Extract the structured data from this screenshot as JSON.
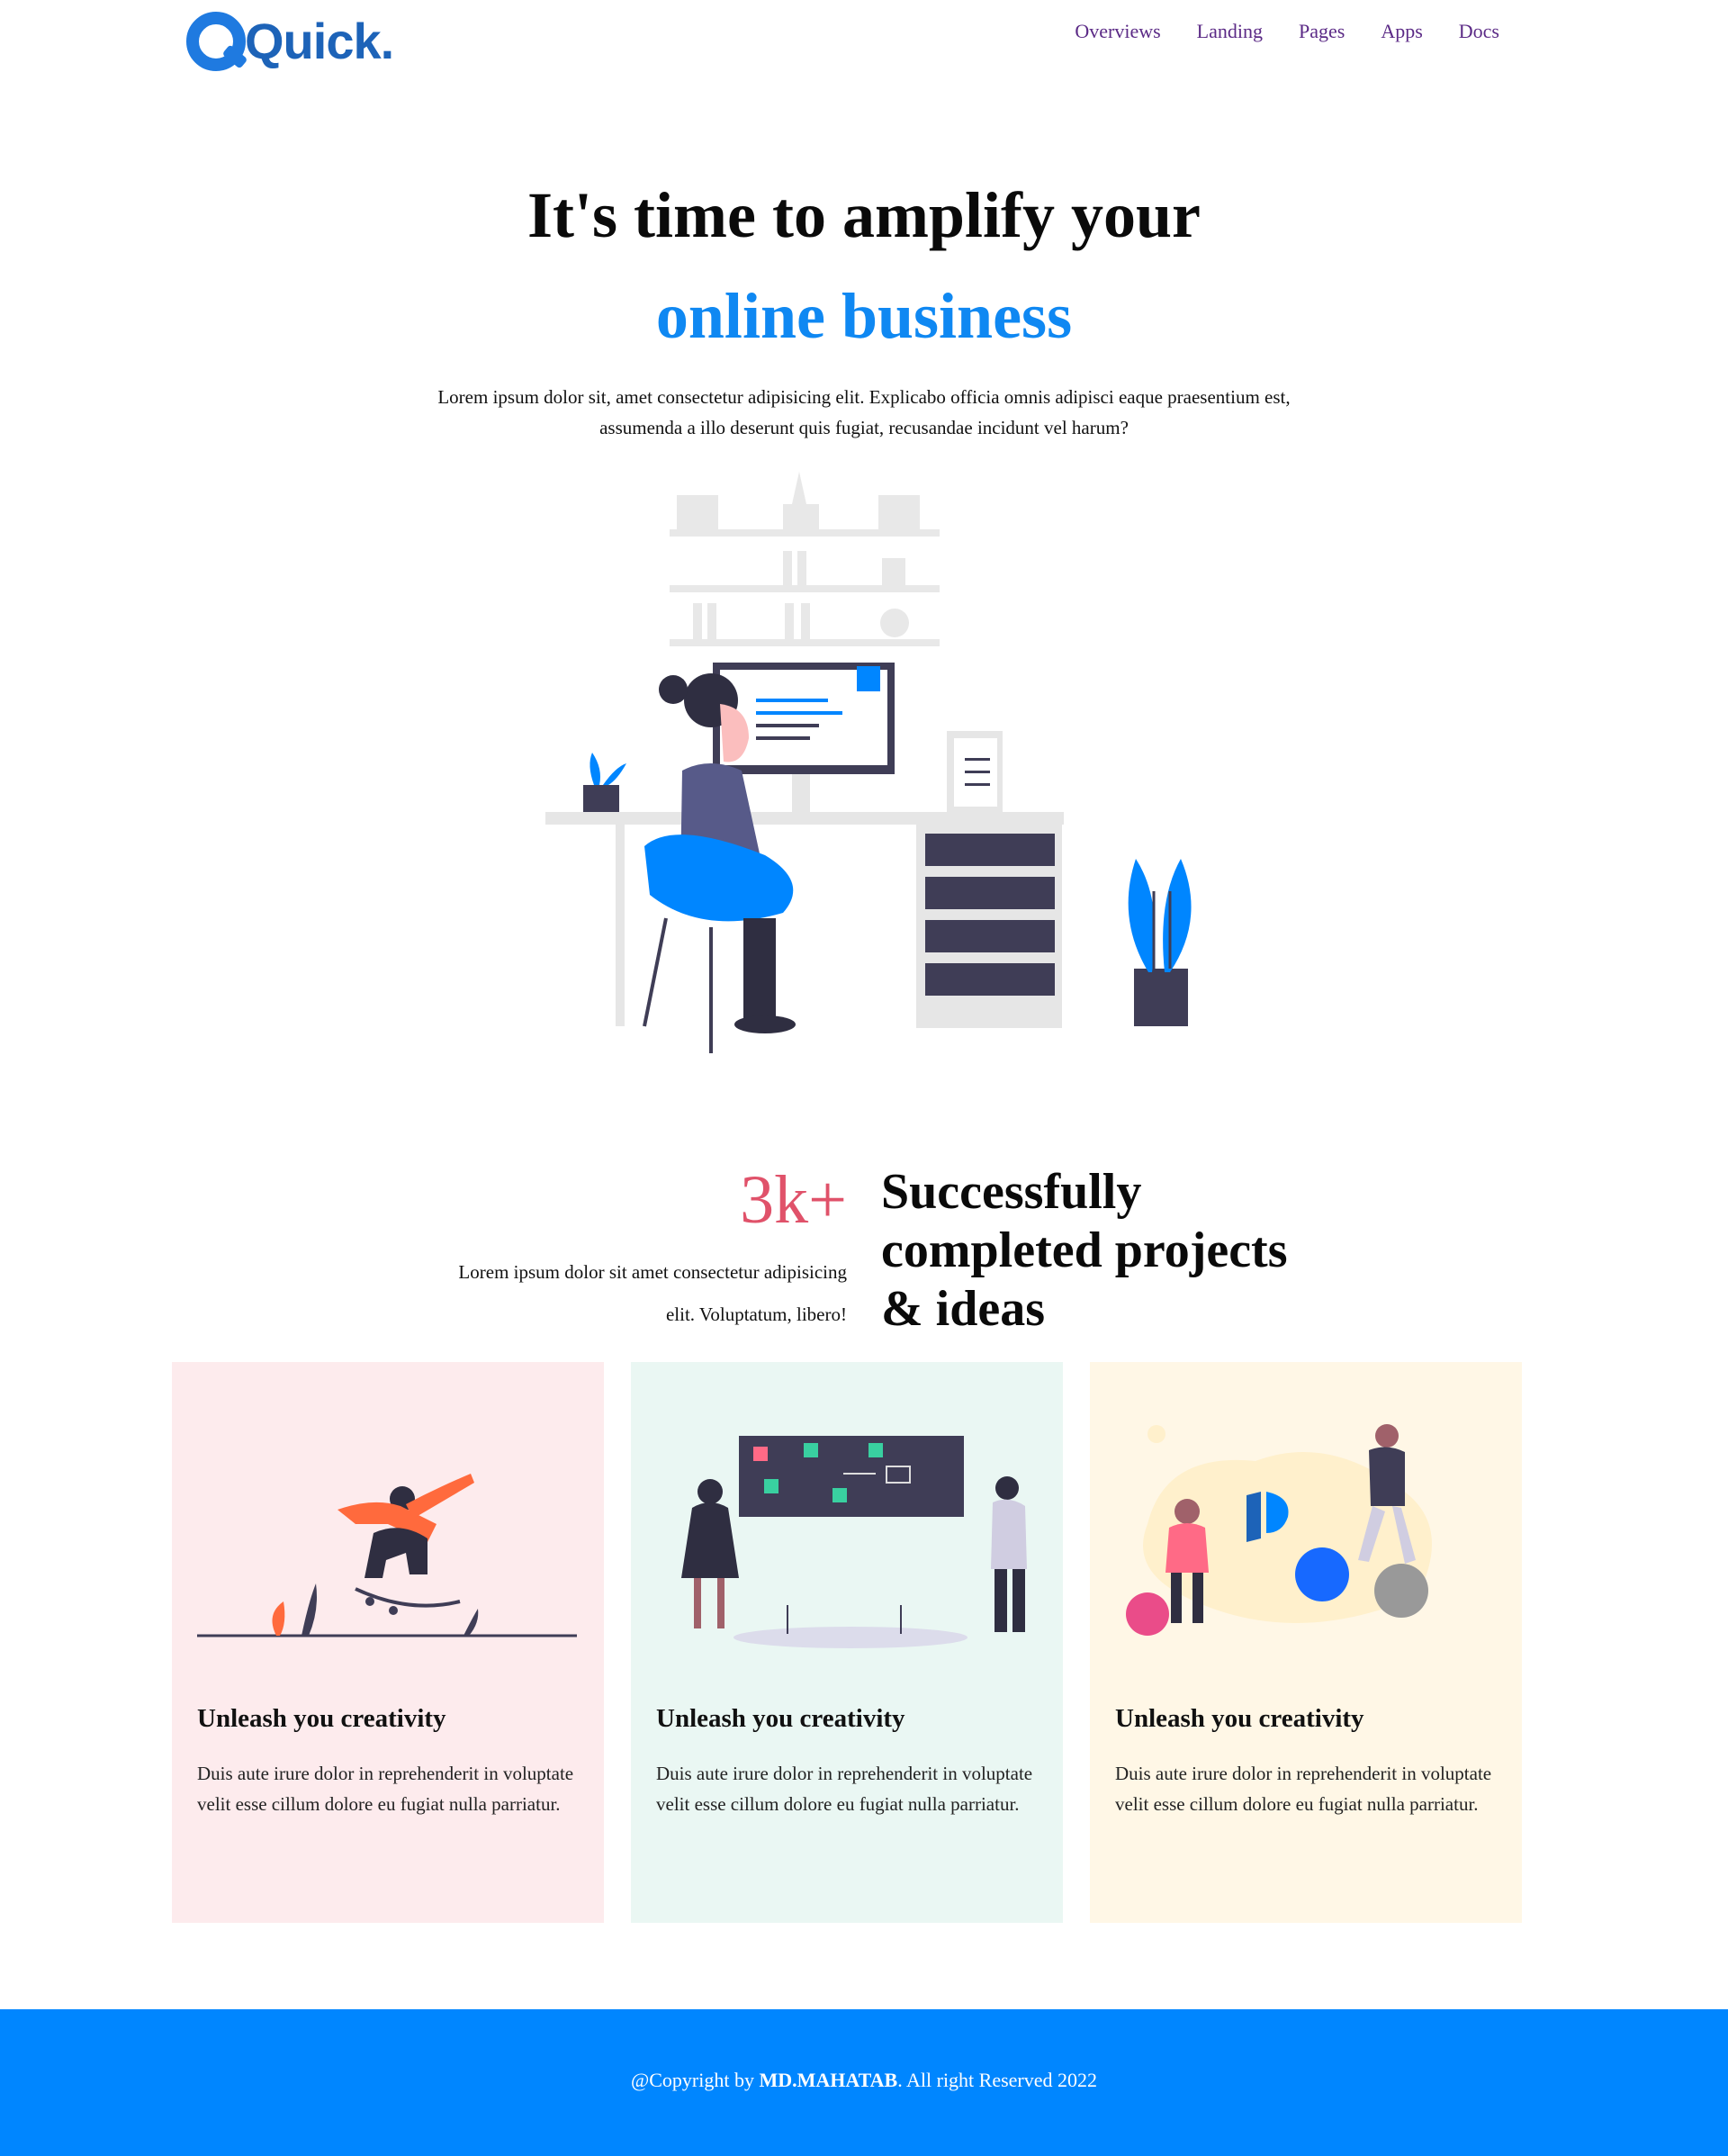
{
  "header": {
    "logo_text": "Quick.",
    "nav": [
      "Overviews",
      "Landing",
      "Pages",
      "Apps",
      "Docs"
    ]
  },
  "hero": {
    "title_line1": "It's time to amplify your",
    "title_line2": "online business",
    "description": "Lorem ipsum dolor sit, amet consectetur adipisicing elit. Explicabo officia omnis adipisci eaque praesentium est, assumenda a illo deserunt quis fugiat, recusandae incidunt vel harum?"
  },
  "stats": {
    "number": "3k+",
    "description": "Lorem ipsum dolor sit amet consectetur adipisicing elit. Voluptatum, libero!",
    "title": "Successfully completed projects & ideas"
  },
  "cards": [
    {
      "title": "Unleash you creativity",
      "text": "Duis aute irure dolor in reprehenderit in voluptate velit esse cillum dolore eu fugiat nulla parriatur.",
      "bg": "#fdebed"
    },
    {
      "title": "Unleash you creativity",
      "text": "Duis aute irure dolor in reprehenderit in voluptate velit esse cillum dolore eu fugiat nulla parriatur.",
      "bg": "#eaf7f3"
    },
    {
      "title": "Unleash you creativity",
      "text": "Duis aute irure dolor in reprehenderit in voluptate velit esse cillum dolore eu fugiat nulla parriatur.",
      "bg": "#fff7e6"
    }
  ],
  "footer": {
    "prefix": "@Copyright by ",
    "author": "MD.MAHATAB",
    "suffix": ". All right Reserved 2022"
  },
  "colors": {
    "accent": "#0086ff",
    "stat": "#e0526a",
    "nav_link": "#5b2a86"
  }
}
